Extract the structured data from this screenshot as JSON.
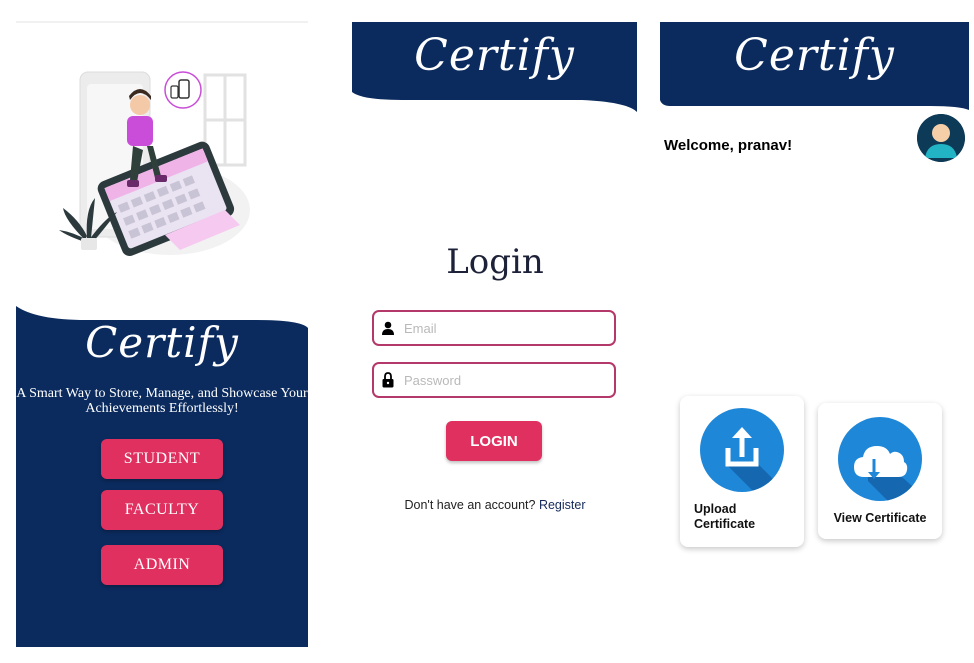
{
  "colors": {
    "navy": "#0b2b5e",
    "accent": "#e0305f",
    "field_border": "#b5386a",
    "icon_blue": "#1f87d8"
  },
  "welcome_screen": {
    "brand": "Certify",
    "tagline": "A Smart Way to Store, Manage, and Showcase Your Achievements Effortlessly!",
    "roles": [
      "STUDENT",
      "FACULTY",
      "ADMIN"
    ]
  },
  "login_screen": {
    "brand": "Certify",
    "title": "Login",
    "email_placeholder": "Email",
    "password_placeholder": "Password",
    "login_label": "LOGIN",
    "no_account_text": "Don't have an account?",
    "register_label": "Register"
  },
  "dashboard_screen": {
    "brand": "Certify",
    "welcome": "Welcome, pranav!",
    "cards": [
      {
        "label": "Upload Certificate",
        "icon": "upload-icon"
      },
      {
        "label": "View Certificate",
        "icon": "cloud-download-icon"
      }
    ]
  }
}
